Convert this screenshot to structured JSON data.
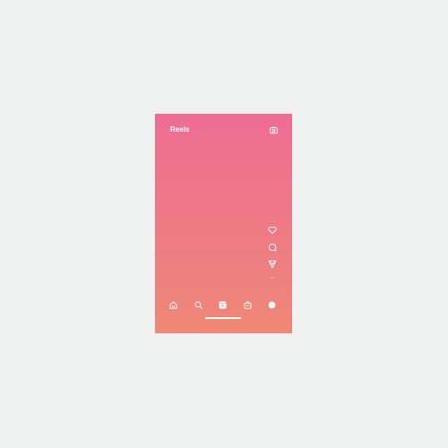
{
  "header": {
    "title": "Reels",
    "camera_icon": "camera-icon"
  },
  "actions": [
    {
      "name": "like",
      "icon": "heart-icon"
    },
    {
      "name": "comment",
      "icon": "comment-icon"
    },
    {
      "name": "share",
      "icon": "send-icon"
    },
    {
      "name": "more",
      "icon": "more-icon"
    }
  ],
  "bottom_nav": [
    {
      "name": "home",
      "icon": "home-icon"
    },
    {
      "name": "search",
      "icon": "search-icon"
    },
    {
      "name": "reels",
      "icon": "reels-icon",
      "active": true
    },
    {
      "name": "shop",
      "icon": "shop-icon"
    },
    {
      "name": "profile",
      "icon": "profile-avatar-icon"
    }
  ],
  "colors": {
    "gradient_top": "#ee6d93",
    "gradient_bottom": "#ef8876",
    "foreground": "#ffffff",
    "page_background": "#f0f1f1"
  }
}
